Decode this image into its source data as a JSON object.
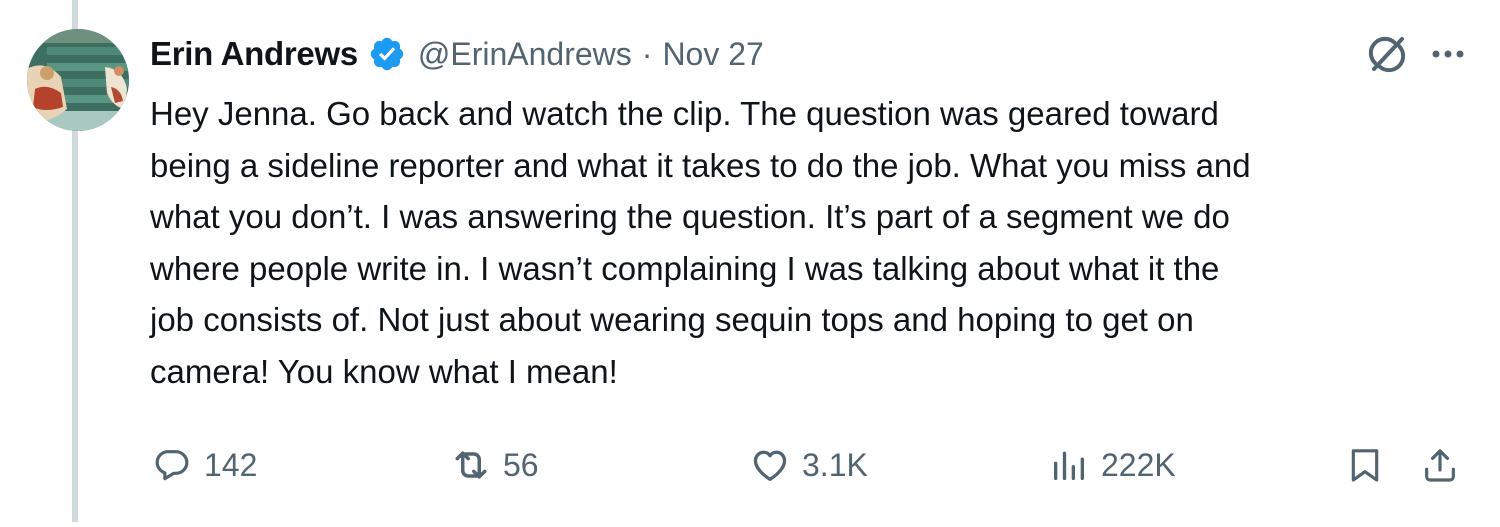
{
  "author": {
    "name": "Erin Andrews",
    "handle": "@ErinAndrews",
    "separator": "·",
    "date": "Nov 27",
    "verified": true,
    "avatar_icon": "profile-photo"
  },
  "tweet": {
    "text": "Hey Jenna. Go back and watch the clip. The question was geared toward\nbeing a sideline reporter and what it takes to do the job. What you miss and\nwhat you don’t. I was answering the question. It’s part of a segment we do\nwhere people write in. I wasn’t complaining I was talking about what it the\njob consists of. Not just about wearing sequin tops and hoping to get on\ncamera! You know what I mean!"
  },
  "stats": {
    "replies": "142",
    "reposts": "56",
    "likes": "3.1K",
    "views": "222K"
  },
  "icons": {
    "reply": "reply-icon",
    "repost": "repost-icon",
    "like": "heart-icon",
    "views": "views-icon",
    "bookmark": "bookmark-icon",
    "share": "share-icon",
    "grok": "grok-icon",
    "more": "more-icon",
    "verified": "verified-badge-icon"
  },
  "colors": {
    "text": "#0f1419",
    "secondary": "#536471",
    "verified": "#1d9bf0",
    "thread_line": "#cfd9de"
  }
}
